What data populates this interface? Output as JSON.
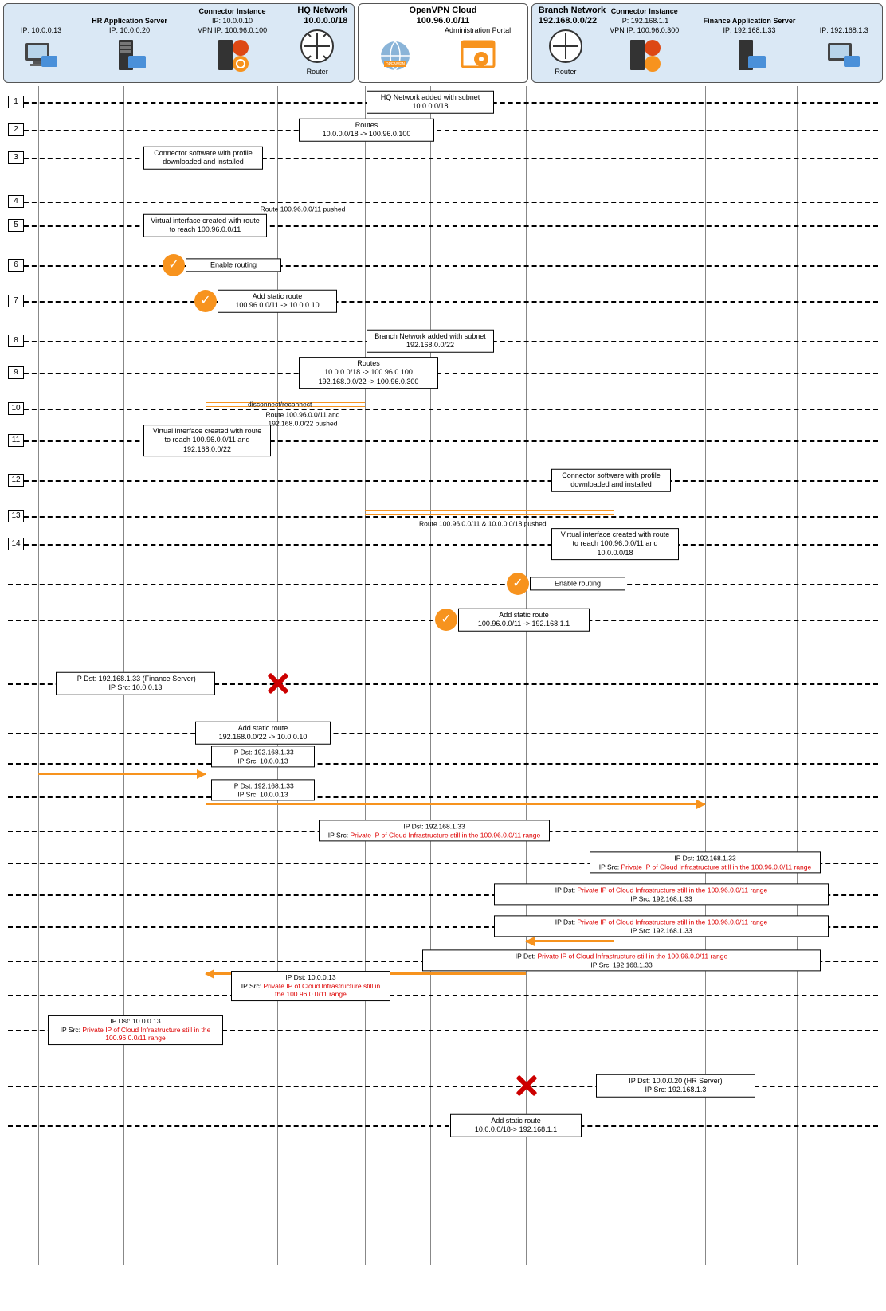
{
  "hq": {
    "title": "HQ Network",
    "subnet": "10.0.0.0/18",
    "clientA": "IP: 10.0.0.13",
    "hr": {
      "name": "HR Application Server",
      "ip": "IP: 10.0.0.20"
    },
    "conn": {
      "name": "Connector Instance",
      "ip": "IP: 10.0.0.10",
      "vpnip": "VPN IP: 100.96.0.100"
    },
    "router": "Router"
  },
  "cloud": {
    "title": "OpenVPN Cloud",
    "subnet": "100.96.0.0/11",
    "portal": "Administration Portal"
  },
  "branch": {
    "title": "Branch Network",
    "subnet": "192.168.0.0/22",
    "router": "Router",
    "conn": {
      "name": "Connector Instance",
      "ip": "IP: 192.168.1.1",
      "vpnip": "VPN IP: 100.96.0.300"
    },
    "fin": {
      "name": "Finance Application Server",
      "ip": "IP: 192.168.1.33"
    },
    "clientB": "IP: 192.168.1.3"
  },
  "s": {
    "t1": "HQ Network added with subnet 10.0.0.0/18",
    "t2a": "Routes",
    "t2b": "10.0.0.0/18 -> 100.96.0.100",
    "t3": "Connector software with profile downloaded and installed",
    "t4b": "Route 100.96.0.0/11 pushed",
    "t5": "Virtual interface created with route to reach 100.96.0.0/11",
    "t6": "Enable routing",
    "t7a": "Add static route",
    "t7b": "100.96.0.0/11 -> 10.0.0.10",
    "t8": "Branch Network added with subnet 192.168.0.0/22",
    "t9a": "Routes",
    "t9b": "10.0.0.0/18 -> 100.96.0.100",
    "t9c": "192.168.0.0/22 -> 100.96.0.300",
    "t10a": "disconnect/reconnect",
    "t10b": "Route 100.96.0.0/11 and 192.168.0.0/22 pushed",
    "t11": "Virtual interface created with route to reach 100.96.0.0/11 and 192.168.0.0/22",
    "t12": "Connector software with profile downloaded and installed",
    "t13b": "Route 100.96.0.0/11 & 10.0.0.0/18 pushed",
    "t14": "Virtual interface created with route to reach 100.96.0.0/11 and 10.0.0.0/18",
    "t15": "Enable routing",
    "t16a": "Add static route",
    "t16b": "100.96.0.0/11 -> 192.168.1.1",
    "p1a": "IP Dst: 192.168.1.33 (Finance Server)",
    "p1b": "IP Src: 10.0.0.13",
    "sr1a": "Add static route",
    "sr1b": "192.168.0.0/22 -> 10.0.0.10",
    "p2a": "IP Dst: 192.168.1.33",
    "p2b": "IP Src: 10.0.0.13",
    "p3a": "IP Dst: 192.168.1.33",
    "p3b": "IP Src: 10.0.0.13",
    "p4a": "IP Dst: 192.168.1.33",
    "p4b": "IP Src: ",
    "p4c": "Private IP of Cloud Infrastructure still in the 100.96.0.0/11 range",
    "p5a": "IP Dst: 192.168.1.33",
    "p5b": "IP Src: ",
    "p5c": "Private IP of Cloud Infrastructure still in the 100.96.0.0/11 range",
    "p6a": "IP Dst: ",
    "p6b": "Private IP of Cloud Infrastructure still in the 100.96.0.0/11 range",
    "p6c": "IP Src: 192.168.1.33",
    "p7a": "IP Dst: ",
    "p7b": "Private IP of Cloud Infrastructure still in the 100.96.0.0/11 range",
    "p7c": "IP Src: 192.168.1.33",
    "p8a": "IP Dst: ",
    "p8b": "Private IP of Cloud Infrastructure still in the 100.96.0.0/11 range",
    "p8c": "IP Src: 192.168.1.33",
    "p9a": "IP Dst: 10.0.0.13",
    "p9b": "IP Src: ",
    "p9c": "Private IP of Cloud Infrastructure still in the 100.96.0.0/11 range",
    "p10a": "IP Dst: 10.0.0.13",
    "p10b": "IP Src: ",
    "p10c": "Private IP of Cloud Infrastructure still in the 100.96.0.0/11 range",
    "p11a": "IP Dst: 10.0.0.20 (HR Server)",
    "p11b": "IP Src: 192.168.1.3",
    "sr2a": "Add static route",
    "sr2b": "10.0.0.0/18-> 192.168.1.1"
  }
}
